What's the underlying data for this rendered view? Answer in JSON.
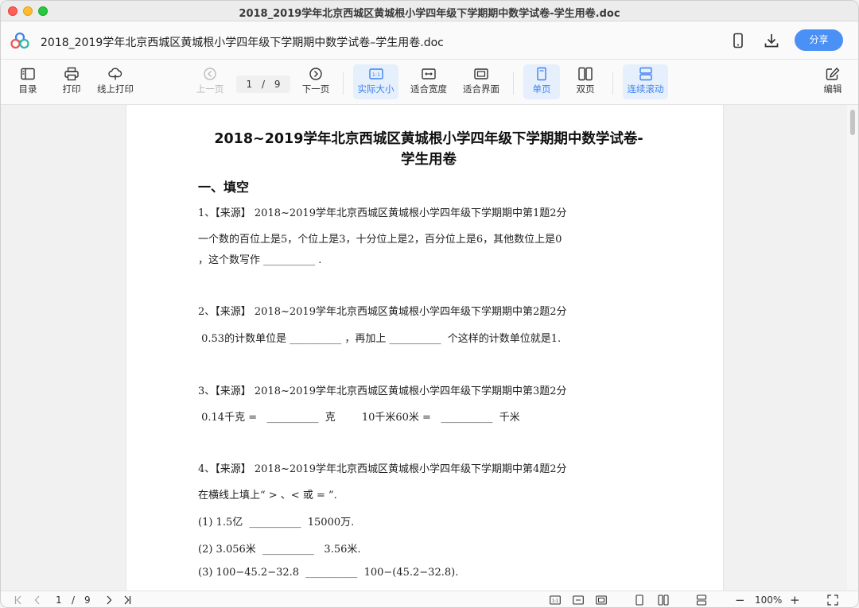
{
  "window": {
    "title": "2018_2019学年北京西城区黄城根小学四年级下学期期中数学试卷-学生用卷.doc"
  },
  "header": {
    "doc_name": "2018_2019学年北京西城区黄城根小学四年级下学期期中数学试卷–学生用卷.doc",
    "share_label": "分享",
    "icons": [
      "phone-icon",
      "download-icon"
    ],
    "accent": "#4a90f5"
  },
  "toolbar": {
    "toc": "目录",
    "print": "打印",
    "online_print": "线上打印",
    "prev": "上一页",
    "page_current": "1",
    "page_sep": "/",
    "page_total": "9",
    "next": "下一页",
    "actual_size": "实际大小",
    "fit_width": "适合宽度",
    "fit_page": "适合界面",
    "single_page": "单页",
    "double_page": "双页",
    "continuous": "连续滚动",
    "edit": "编辑"
  },
  "document": {
    "title_line1": "2018~2019学年北京西城区黄城根小学四年级下学期期中数学试卷-",
    "title_line2": "学生用卷",
    "section1": "一、填空",
    "lines": [
      "1、【来源】 2018~2019学年北京西城区黄城根小学四年级下学期期中第1题2分",
      "一个数的百位上是5，个位上是3，十分位上是2，百分位上是6，其他数位上是0",
      "，这个数写作 __________ .",
      "2、【来源】 2018~2019学年北京西城区黄城根小学四年级下学期期中第2题2分",
      " 0.53的计数单位是 __________ ，再加上 __________  个这样的计数单位就是1.",
      "3、【来源】 2018~2019学年北京西城区黄城根小学四年级下学期期中第3题2分",
      " 0.14千克 =   __________  克        10千米60米 =   __________  千米",
      "4、【来源】 2018~2019学年北京西城区黄城根小学四年级下学期期中第4题2分",
      "在横线上填上“ > 、< 或 = ”.",
      "(1) 1.5亿  __________  15000万.",
      "(2) 3.056米  __________   3.56米.",
      "(3) 100−45.2−32.8  __________  100−(45.2−32.8)."
    ]
  },
  "statusbar": {
    "page_current": "1",
    "page_sep": "/",
    "page_total": "9",
    "zoom": "100%",
    "zoom_minus": "−",
    "zoom_plus": "+"
  }
}
